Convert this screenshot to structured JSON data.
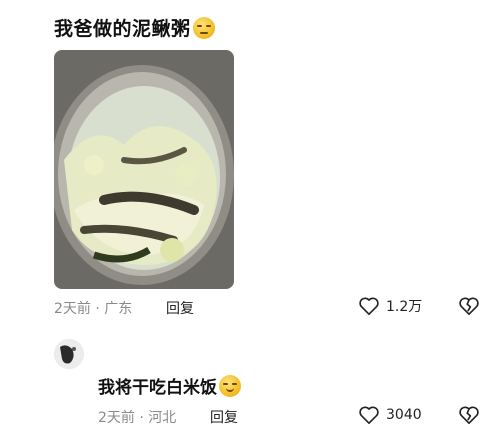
{
  "comments": [
    {
      "text": "我爸做的泥鳅粥",
      "emoji": "neutral-face-emoji",
      "time": "2天前",
      "location": "广东",
      "reply_label": "回复",
      "likes": "1.2万"
    },
    {
      "text": "我将干吃白米饭",
      "emoji": "smile-emoji",
      "time": "2天前",
      "location": "河北",
      "reply_label": "回复",
      "likes": "3040"
    }
  ],
  "separator": "·",
  "icons": {
    "like": "heart-outline-icon",
    "dislike": "broken-heart-icon"
  },
  "colors": {
    "meta_text": "#8a8a8a",
    "primary_text": "#111111"
  }
}
